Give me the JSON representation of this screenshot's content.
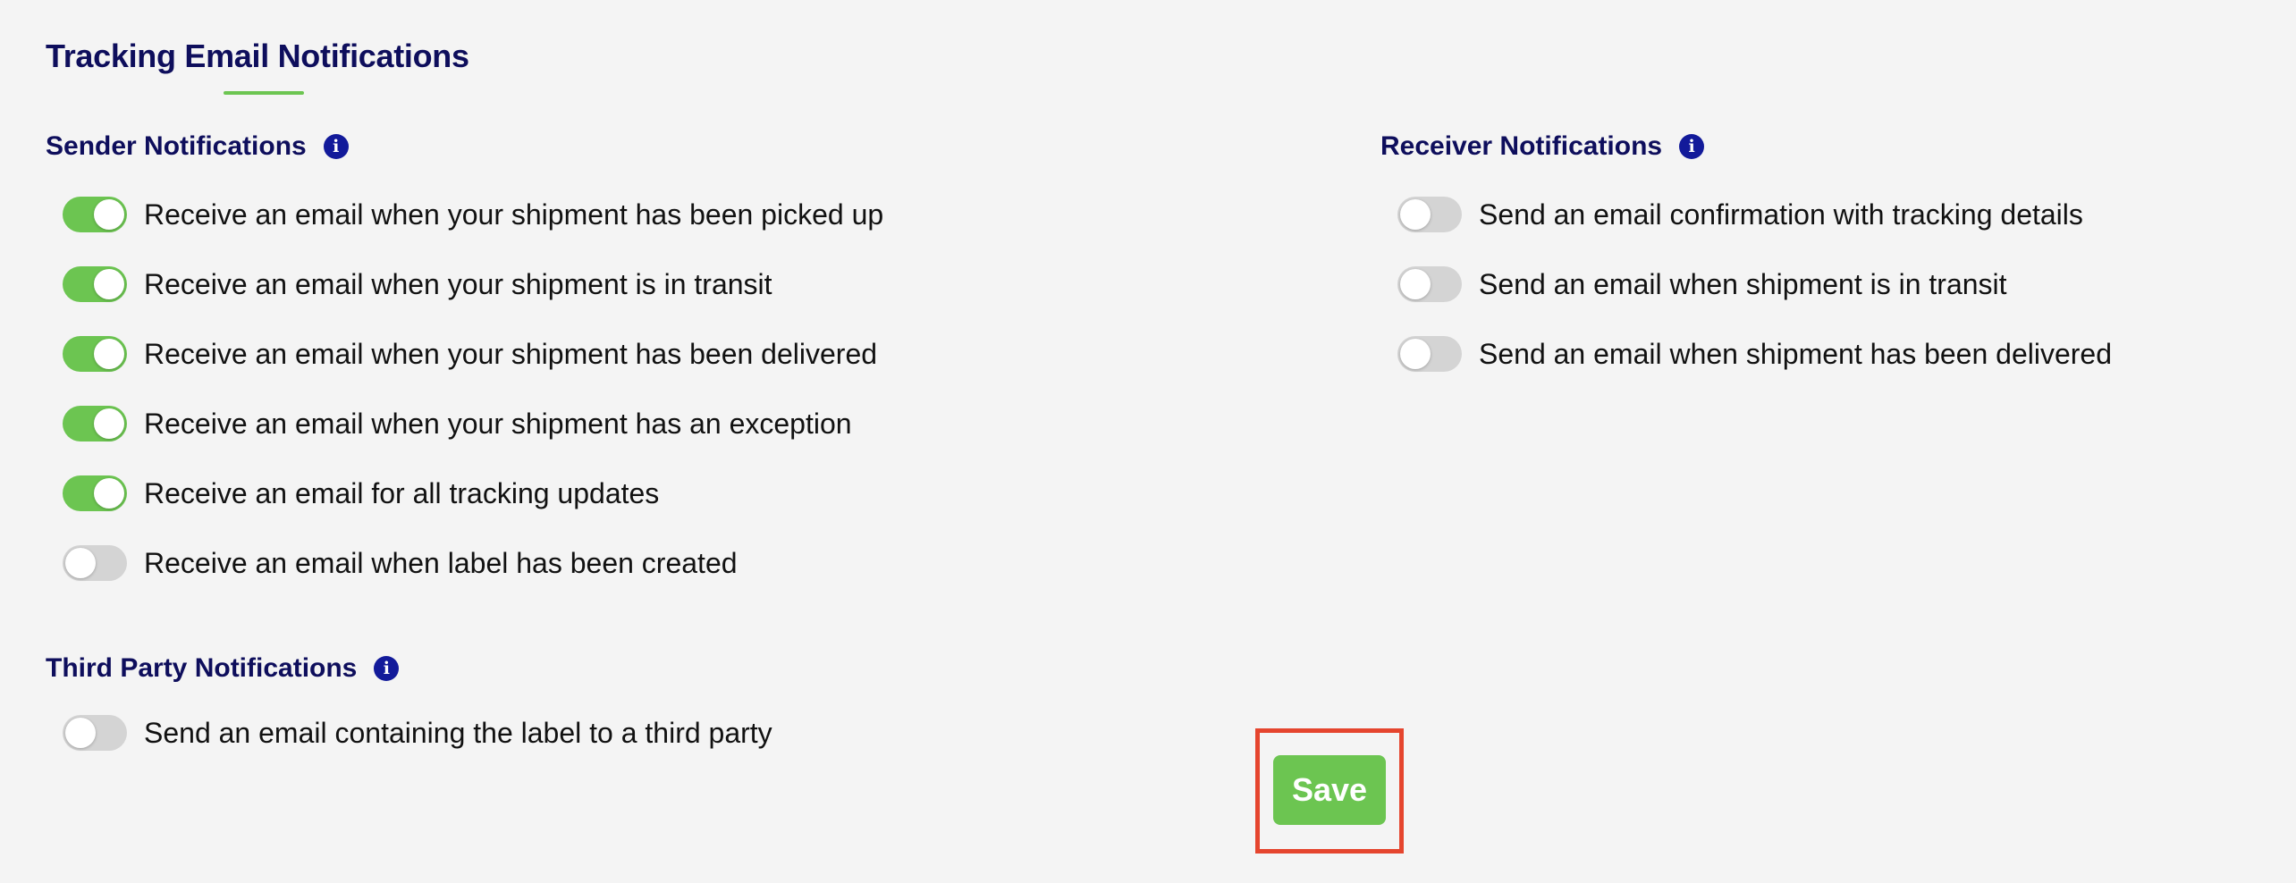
{
  "page": {
    "title": "Tracking Email Notifications"
  },
  "sender": {
    "title": "Sender Notifications",
    "info_icon": "info-icon",
    "items": [
      {
        "label": "Receive an email when your shipment has been picked up",
        "enabled": true
      },
      {
        "label": "Receive an email when your shipment is in transit",
        "enabled": true
      },
      {
        "label": "Receive an email when your shipment has been delivered",
        "enabled": true
      },
      {
        "label": "Receive an email when your shipment has an exception",
        "enabled": true
      },
      {
        "label": "Receive an email for all tracking updates",
        "enabled": true
      },
      {
        "label": "Receive an email when label has been created",
        "enabled": false
      }
    ]
  },
  "receiver": {
    "title": "Receiver Notifications",
    "info_icon": "info-icon",
    "items": [
      {
        "label": "Send an email confirmation with tracking details",
        "enabled": false
      },
      {
        "label": "Send an email when shipment is in transit",
        "enabled": false
      },
      {
        "label": "Send an email when shipment has been delivered",
        "enabled": false
      }
    ]
  },
  "third_party": {
    "title": "Third Party Notifications",
    "info_icon": "info-icon",
    "items": [
      {
        "label": "Send an email containing the label to a third party",
        "enabled": false
      }
    ]
  },
  "actions": {
    "save_label": "Save"
  },
  "colors": {
    "heading": "#0e0e5c",
    "accent_green": "#6cc551",
    "info_icon_bg": "#121a9a",
    "toggle_off": "#d4d4d4",
    "highlight_frame": "#e5452e",
    "background": "#f4f4f4"
  }
}
